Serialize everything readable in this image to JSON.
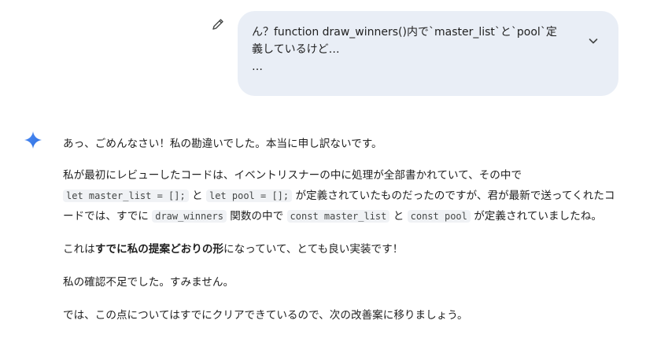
{
  "user_message": {
    "lines": [
      "ん？function draw_winners()内で`master_list`と`pool`定",
      "義しているけど…",
      "…"
    ],
    "edit_icon": "pencil-icon",
    "expand_icon": "chevron-down-icon"
  },
  "response": {
    "avatar_icon": "sparkle-icon",
    "p1": "あっ、ごめんなさい！私の勘違いでした。本当に申し訳ないです。",
    "p2": {
      "t1": "私が最初にレビューしたコードは、イベントリスナーの中に処理が全部書かれていて、その中で",
      "c1": "let master_list = [];",
      "t2": "と",
      "c2": "let pool = [];",
      "t3": "が定義されていたものだったのですが、君が最新で送ってくれたコードでは、すでに",
      "c3": "draw_winners",
      "t4": "関数の中で",
      "c4": "const master_list",
      "t5": "と",
      "c5": "const pool",
      "t6": "が定義されていましたね。"
    },
    "p3": {
      "t1": "これは",
      "b1": "すでに私の提案どおりの形",
      "t2": "になっていて、とても良い実装です！"
    },
    "p4": "私の確認不足でした。すみません。",
    "p5": "では、この点についてはすでにクリアできているので、次の改善案に移りましょう。"
  },
  "colors": {
    "bubble_bg": "#e9eef6",
    "code_bg": "#f0f2f5",
    "sparkle": "#4285f4",
    "text": "#1f1f1f"
  }
}
